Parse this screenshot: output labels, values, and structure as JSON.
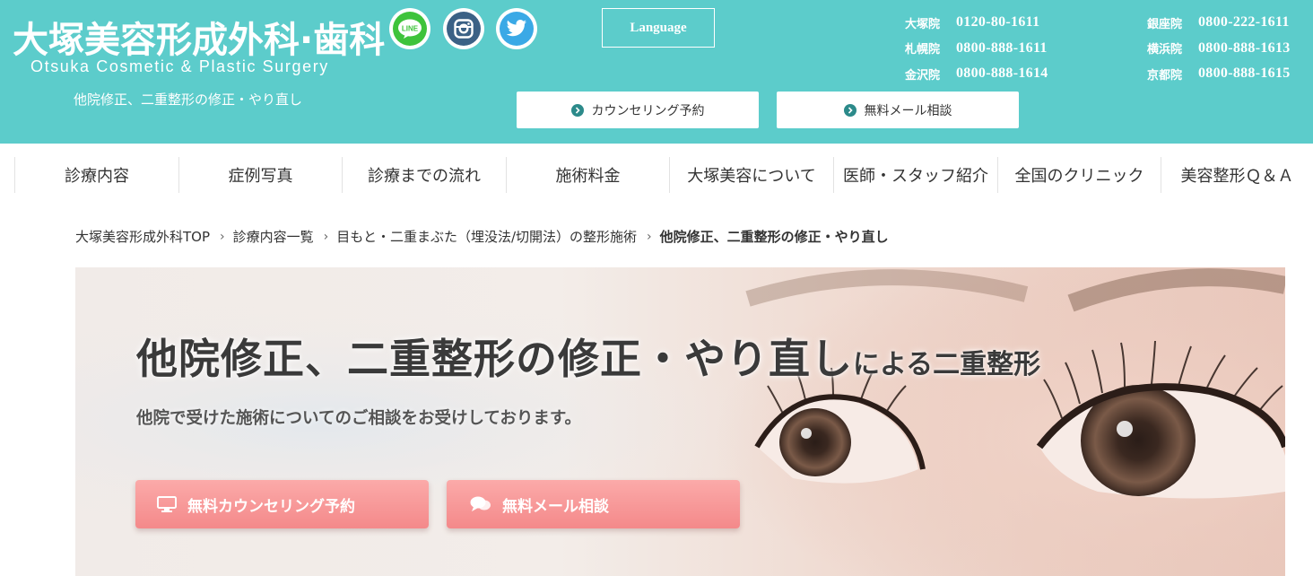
{
  "header": {
    "logo_jp": "大塚美容形成外科·歯科",
    "logo_en": "Otsuka Cosmetic & Plastic Surgery",
    "tagline": "他院修正、二重整形の修正・やり直し",
    "language_label": "Language",
    "counsel_button": "カウンセリング予約",
    "mail_button": "無料メール相談",
    "social": [
      {
        "name": "line",
        "label": "LINE",
        "color": "#3ec33b"
      },
      {
        "name": "instagram",
        "color": "#3b6185"
      },
      {
        "name": "twitter",
        "color": "#3aa9e6"
      }
    ],
    "phones_left": [
      {
        "clinic": "大塚院",
        "number": "0120-80-1611"
      },
      {
        "clinic": "札幌院",
        "number": "0800-888-1611"
      },
      {
        "clinic": "金沢院",
        "number": "0800-888-1614"
      }
    ],
    "phones_right": [
      {
        "clinic": "銀座院",
        "number": "0800-222-1611"
      },
      {
        "clinic": "横浜院",
        "number": "0800-888-1613"
      },
      {
        "clinic": "京都院",
        "number": "0800-888-1615"
      }
    ]
  },
  "nav": [
    {
      "label": "診療内容"
    },
    {
      "label": "症例写真"
    },
    {
      "label": "診療までの流れ"
    },
    {
      "label": "施術料金"
    },
    {
      "label": "大塚美容について"
    },
    {
      "label": "医師・スタッフ紹介"
    },
    {
      "label": "全国のクリニック"
    },
    {
      "label": "美容整形Ｑ＆Ａ"
    }
  ],
  "breadcrumb": [
    {
      "label": "大塚美容形成外科TOP"
    },
    {
      "label": "診療内容一覧"
    },
    {
      "label": "目もと・二重まぶた（埋没法/切開法）の整形施術"
    },
    {
      "label": "他院修正、二重整形の修正・やり直し"
    }
  ],
  "hero": {
    "title_main": "他院修正、二重整形の修正・やり直し",
    "title_suffix": "による二重整形",
    "subtitle": "他院で受けた施術についてのご相談をお受けしております。",
    "cta_counsel": "無料カウンセリング予約",
    "cta_mail": "無料メール相談"
  },
  "colors": {
    "header_bg": "#5ccccb",
    "cta_pink": "#f4898a",
    "accent_dot": "#2c8a8a"
  }
}
